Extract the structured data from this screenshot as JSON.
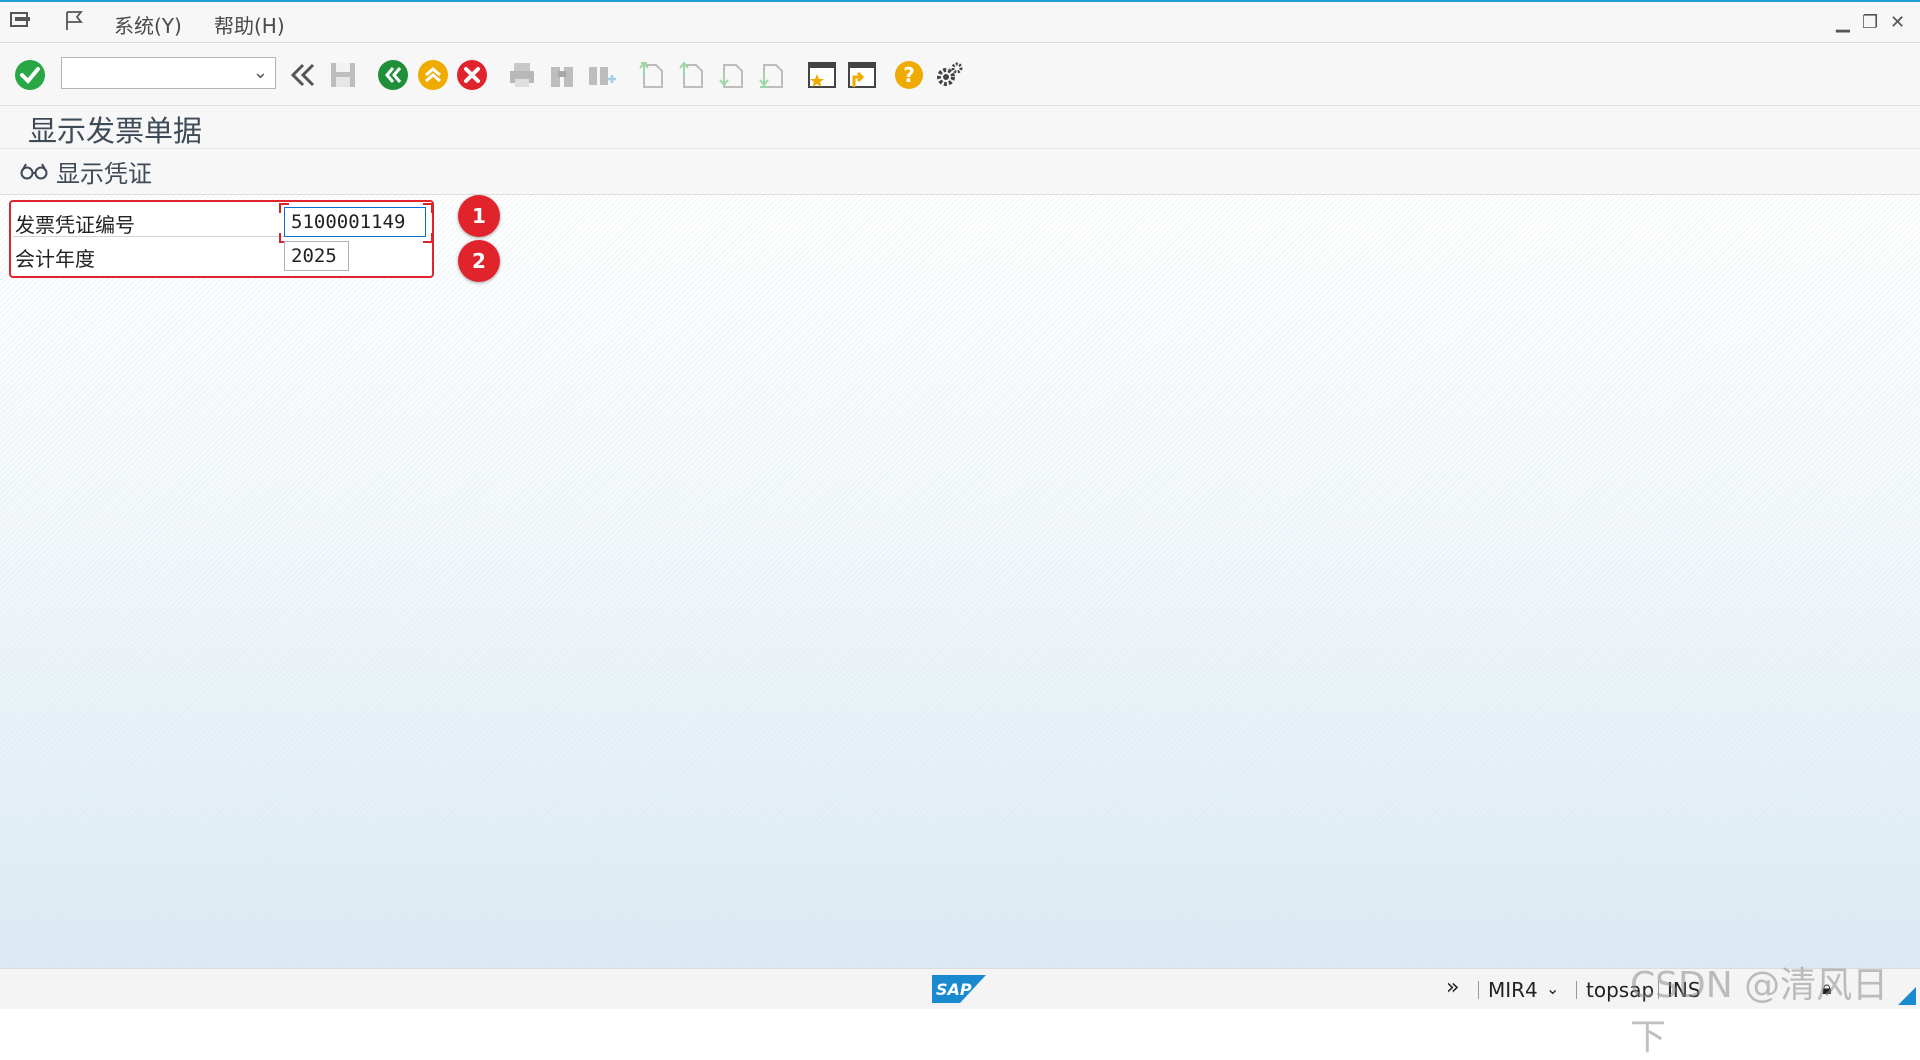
{
  "menu": {
    "system": "系统(Y)",
    "help": "帮助(H)"
  },
  "toolbar": {
    "command_field_value": "",
    "icons": [
      "enter-icon",
      "back-double-chevron-icon",
      "save-icon",
      "back-icon",
      "exit-icon",
      "cancel-icon",
      "print-icon",
      "find-icon",
      "find-next-icon",
      "first-page-icon",
      "previous-page-icon",
      "next-page-icon",
      "last-page-icon",
      "create-session-icon",
      "shortcut-icon",
      "help-icon",
      "settings-icon"
    ]
  },
  "page_title": "显示发票单据",
  "app_toolbar": {
    "display_document_label": "显示凭证"
  },
  "form": {
    "invoice_number_label": "发票凭证编号",
    "invoice_number_value": "5100001149",
    "fiscal_year_label": "会计年度",
    "fiscal_year_value": "2025"
  },
  "annotations": {
    "badge1": "1",
    "badge2": "2"
  },
  "status_bar": {
    "logo": "SAP",
    "transaction": "MIR4",
    "server": "topsap",
    "mode": "INS"
  },
  "watermark": "CSDN @清风日下",
  "colors": {
    "accent_blue": "#1a9fd5",
    "annotation_red": "#e1232c",
    "enter_green": "#2aa745",
    "exit_orange": "#f0ab00",
    "cancel_red": "#e0242e"
  }
}
